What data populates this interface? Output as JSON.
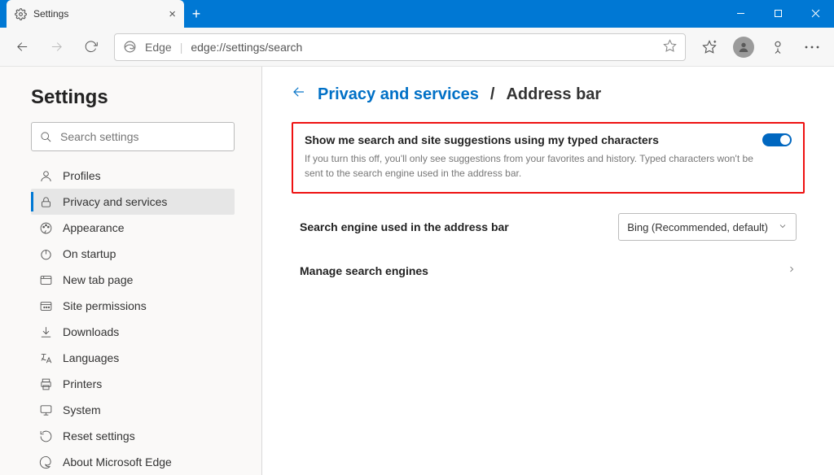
{
  "tab": {
    "title": "Settings"
  },
  "address": {
    "scheme_label": "Edge",
    "url": "edge://settings/search"
  },
  "sidebar": {
    "heading": "Settings",
    "search_placeholder": "Search settings",
    "items": [
      {
        "label": "Profiles"
      },
      {
        "label": "Privacy and services"
      },
      {
        "label": "Appearance"
      },
      {
        "label": "On startup"
      },
      {
        "label": "New tab page"
      },
      {
        "label": "Site permissions"
      },
      {
        "label": "Downloads"
      },
      {
        "label": "Languages"
      },
      {
        "label": "Printers"
      },
      {
        "label": "System"
      },
      {
        "label": "Reset settings"
      },
      {
        "label": "About Microsoft Edge"
      }
    ]
  },
  "breadcrumb": {
    "parent": "Privacy and services",
    "separator": "/",
    "current": "Address bar"
  },
  "rows": {
    "suggestions": {
      "title": "Show me search and site suggestions using my typed characters",
      "desc": "If you turn this off, you'll only see suggestions from your favorites and history. Typed characters won't be sent to the search engine used in the address bar.",
      "toggle": true
    },
    "engine": {
      "title": "Search engine used in the address bar",
      "value": "Bing (Recommended, default)"
    },
    "manage": {
      "title": "Manage search engines"
    }
  }
}
